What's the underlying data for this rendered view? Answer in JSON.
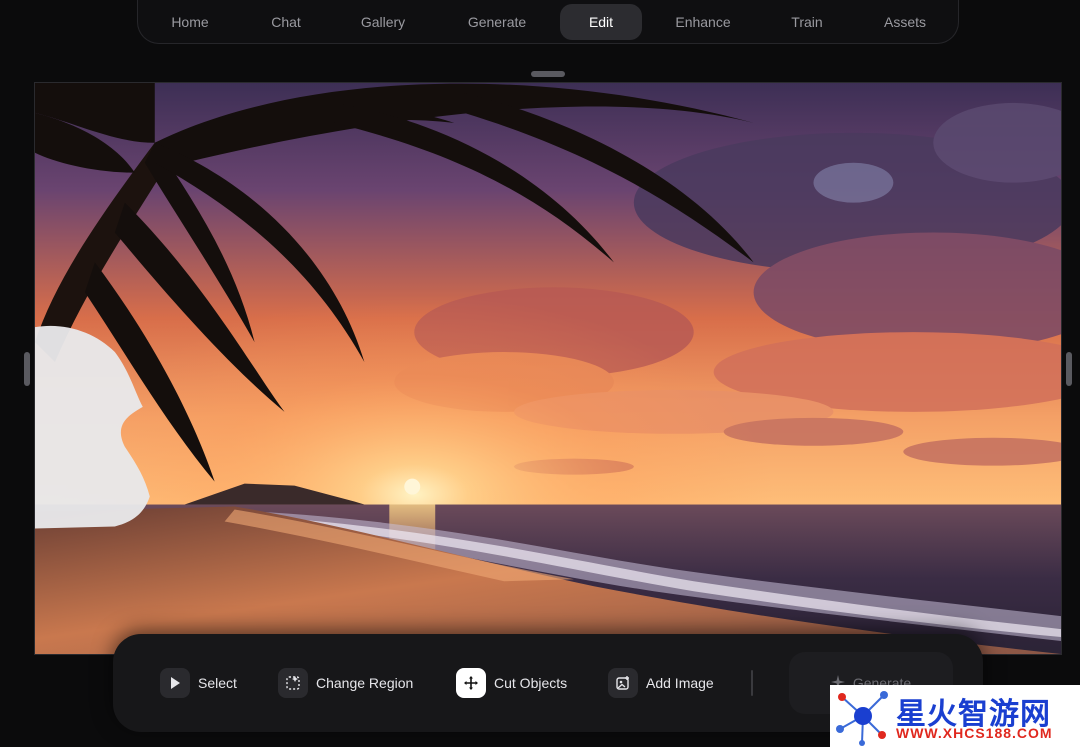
{
  "nav": {
    "items": [
      {
        "label": "Home"
      },
      {
        "label": "Chat"
      },
      {
        "label": "Gallery"
      },
      {
        "label": "Generate"
      },
      {
        "label": "Edit"
      },
      {
        "label": "Enhance"
      },
      {
        "label": "Train"
      },
      {
        "label": "Assets"
      }
    ],
    "active": "Edit"
  },
  "canvas": {
    "image_description_icon": "image-canvas",
    "scene_colors": {
      "sky_top": "#5a3a6e",
      "sky_mid": "#e07a4a",
      "horizon": "#ffb060",
      "sea": "#3a2a3e",
      "sand": "#a86048",
      "mask": "#e6e6e6"
    }
  },
  "toolbar": {
    "tools": [
      {
        "label": "Select",
        "icon": "cursor-icon"
      },
      {
        "label": "Change Region",
        "icon": "sparkle-region-icon"
      },
      {
        "label": "Cut Objects",
        "icon": "move-icon"
      },
      {
        "label": "Add Image",
        "icon": "add-image-icon"
      }
    ],
    "generate_label": "Generate",
    "generate_icon": "sparkle-icon"
  },
  "watermark": {
    "brand_cn": "星火智游网",
    "url": "WWW.XHCS188.COM"
  }
}
